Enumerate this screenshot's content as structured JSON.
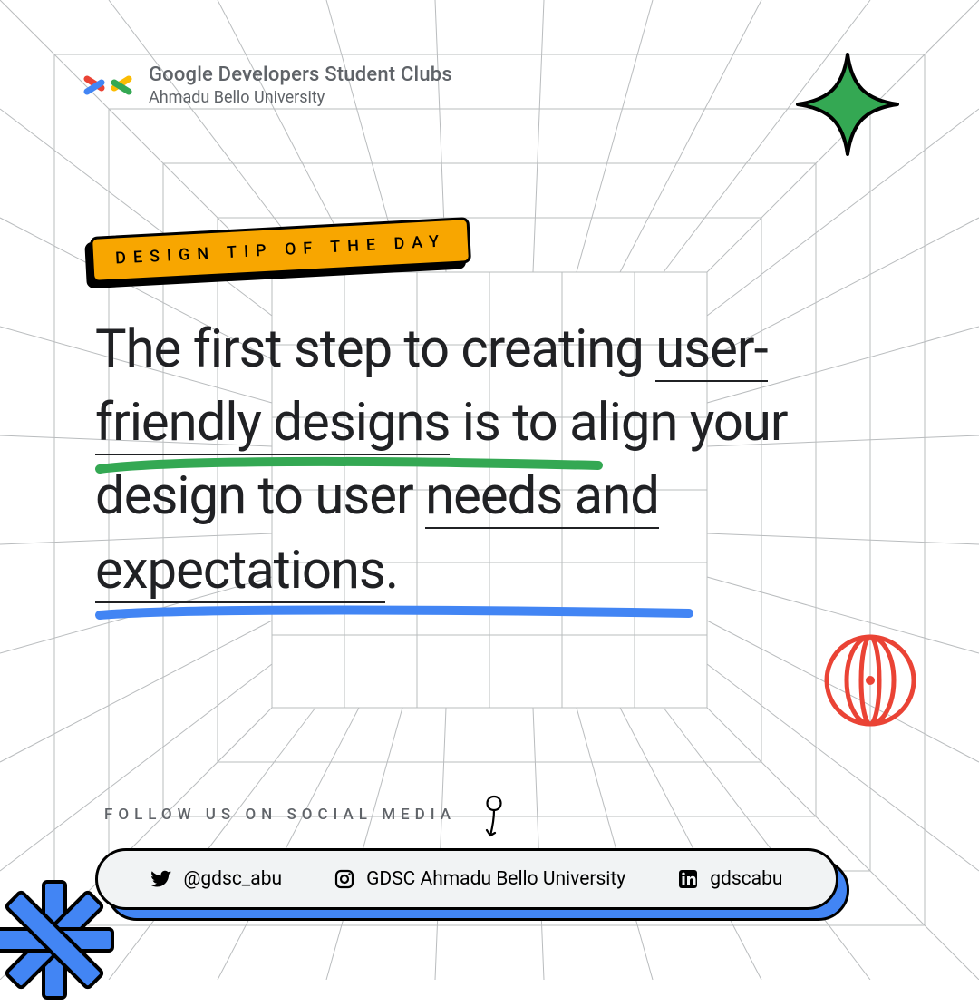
{
  "brand": {
    "title": "Google Developers Student Clubs",
    "subtitle": "Ahmadu Bello University"
  },
  "tag": {
    "label": "DESIGN TIP OF THE DAY"
  },
  "tip": {
    "part1": "The first step to creating ",
    "highlight1": "user-friendly designs",
    "part2": " is to align your design to user ",
    "highlight2": "needs and expectations",
    "part3": "."
  },
  "social": {
    "heading": "FOLLOW US ON SOCIAL MEDIA",
    "twitter": "@gdsc_abu",
    "instagram": "GDSC Ahmadu Bello University",
    "linkedin": "gdscabu"
  },
  "colors": {
    "accent_yellow": "#f8a600",
    "google_green": "#34A853",
    "google_blue": "#4285F4",
    "google_red": "#EA4335"
  }
}
